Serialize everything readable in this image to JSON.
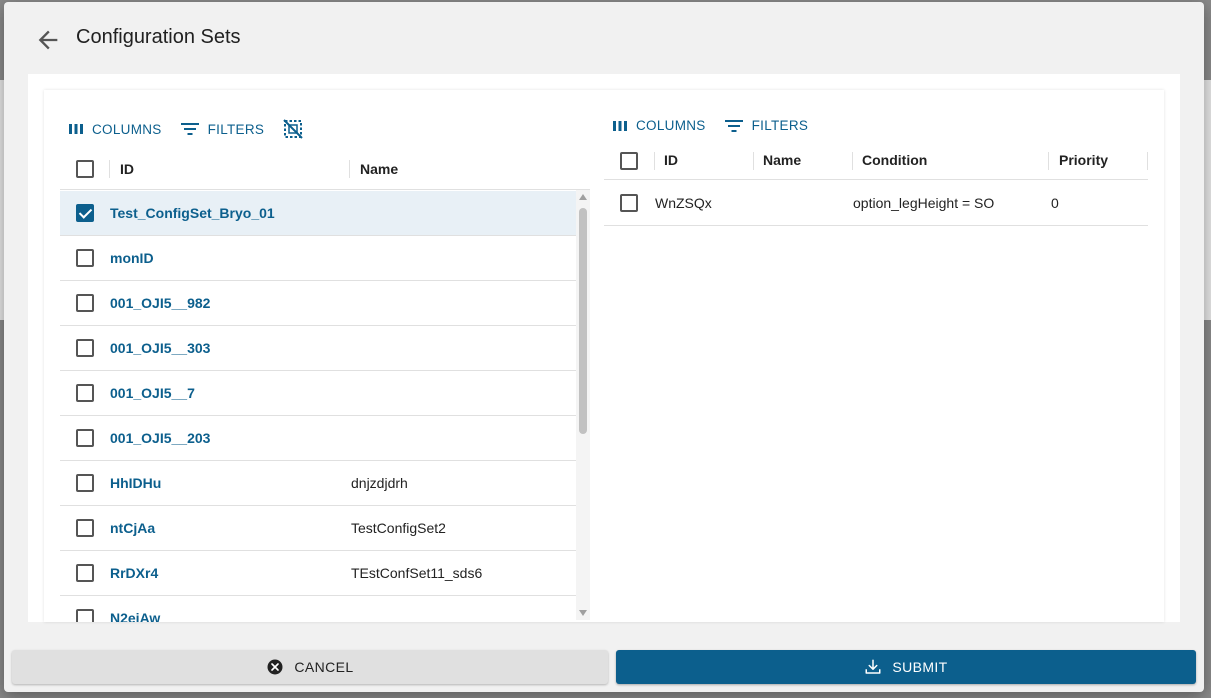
{
  "dialog": {
    "title": "Configuration Sets",
    "cancel_label": "CANCEL",
    "submit_label": "SUBMIT"
  },
  "left_grid": {
    "toolbar": {
      "columns_label": "COLUMNS",
      "filters_label": "FILTERS"
    },
    "columns": [
      "ID",
      "Name"
    ],
    "rows": [
      {
        "id": "Test_ConfigSet_Bryo_01",
        "name": "",
        "checked": true
      },
      {
        "id": "monID",
        "name": "",
        "checked": false
      },
      {
        "id": "001_OJI5__982",
        "name": "",
        "checked": false
      },
      {
        "id": "001_OJI5__303",
        "name": "",
        "checked": false
      },
      {
        "id": "001_OJI5__7",
        "name": "",
        "checked": false
      },
      {
        "id": "001_OJI5__203",
        "name": "",
        "checked": false
      },
      {
        "id": "HhIDHu",
        "name": "dnjzdjdrh",
        "checked": false
      },
      {
        "id": "ntCjAa",
        "name": "TestConfigSet2",
        "checked": false
      },
      {
        "id": "RrDXr4",
        "name": "TEstConfSet11_sds6",
        "checked": false
      },
      {
        "id": "N2ejAw",
        "name": "",
        "checked": false
      }
    ]
  },
  "right_grid": {
    "toolbar": {
      "columns_label": "COLUMNS",
      "filters_label": "FILTERS"
    },
    "columns": [
      "ID",
      "Name",
      "Condition",
      "Priority"
    ],
    "rows": [
      {
        "id": "WnZSQx",
        "name": "",
        "condition": "option_legHeight = SO",
        "priority": "0"
      }
    ]
  },
  "colors": {
    "accent": "#0c5f8d",
    "selected_row": "#e8f0f6"
  },
  "icons": {
    "back": "arrow-left-icon",
    "columns": "view-column-icon",
    "filters": "filter-list-icon",
    "deselect": "deselect-icon",
    "cancel": "cancel-circle-icon",
    "submit": "download-tray-icon"
  }
}
